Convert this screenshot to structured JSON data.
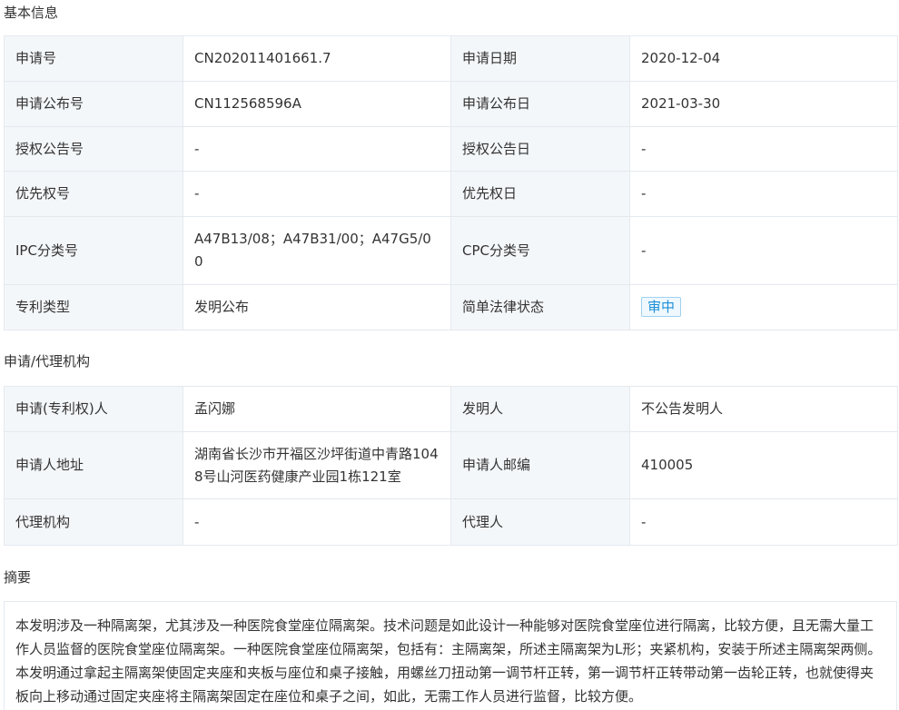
{
  "sections": {
    "basic": "基本信息",
    "agency": "申请/代理机构",
    "abstract": "摘要"
  },
  "basic_info": {
    "app_no_label": "申请号",
    "app_no": "CN202011401661.7",
    "app_date_label": "申请日期",
    "app_date": "2020-12-04",
    "pub_no_label": "申请公布号",
    "pub_no": "CN112568596A",
    "pub_date_label": "申请公布日",
    "pub_date": "2021-03-30",
    "grant_no_label": "授权公告号",
    "grant_no": "-",
    "grant_date_label": "授权公告日",
    "grant_date": "-",
    "priority_no_label": "优先权号",
    "priority_no": "-",
    "priority_date_label": "优先权日",
    "priority_date": "-",
    "ipc_label": "IPC分类号",
    "ipc": "A47B13/08；A47B31/00；A47G5/00",
    "cpc_label": "CPC分类号",
    "cpc": "-",
    "type_label": "专利类型",
    "type": "发明公布",
    "status_label": "简单法律状态",
    "status": "审中"
  },
  "agency_info": {
    "applicant_label": "申请(专利权)人",
    "applicant": "孟闪娜",
    "inventor_label": "发明人",
    "inventor": "不公告发明人",
    "address_label": "申请人地址",
    "address": "湖南省长沙市开福区沙坪街道中青路1048号山河医药健康产业园1栋121室",
    "postcode_label": "申请人邮编",
    "postcode": "410005",
    "agency_label": "代理机构",
    "agency": "-",
    "agent_label": "代理人",
    "agent": "-"
  },
  "abstract_text": "本发明涉及一种隔离架，尤其涉及一种医院食堂座位隔离架。技术问题是如此设计一种能够对医院食堂座位进行隔离，比较方便，且无需大量工作人员监督的医院食堂座位隔离架。一种医院食堂座位隔离架，包括有：主隔离架，所述主隔离架为L形；夹紧机构，安装于所述主隔离架两侧。本发明通过拿起主隔离架使固定夹座和夹板与座位和桌子接触，用螺丝刀扭动第一调节杆正转，第一调节杆正转带动第一齿轮正转，也就使得夹板向上移动通过固定夹座将主隔离架固定在座位和桌子之间，如此，无需工作人员进行监督，比较方便。",
  "colors": {
    "label_bg": "#f4f7fa",
    "border": "#e4e9ee",
    "badge_text": "#1e8fd6",
    "badge_border": "#9fd2ef"
  }
}
